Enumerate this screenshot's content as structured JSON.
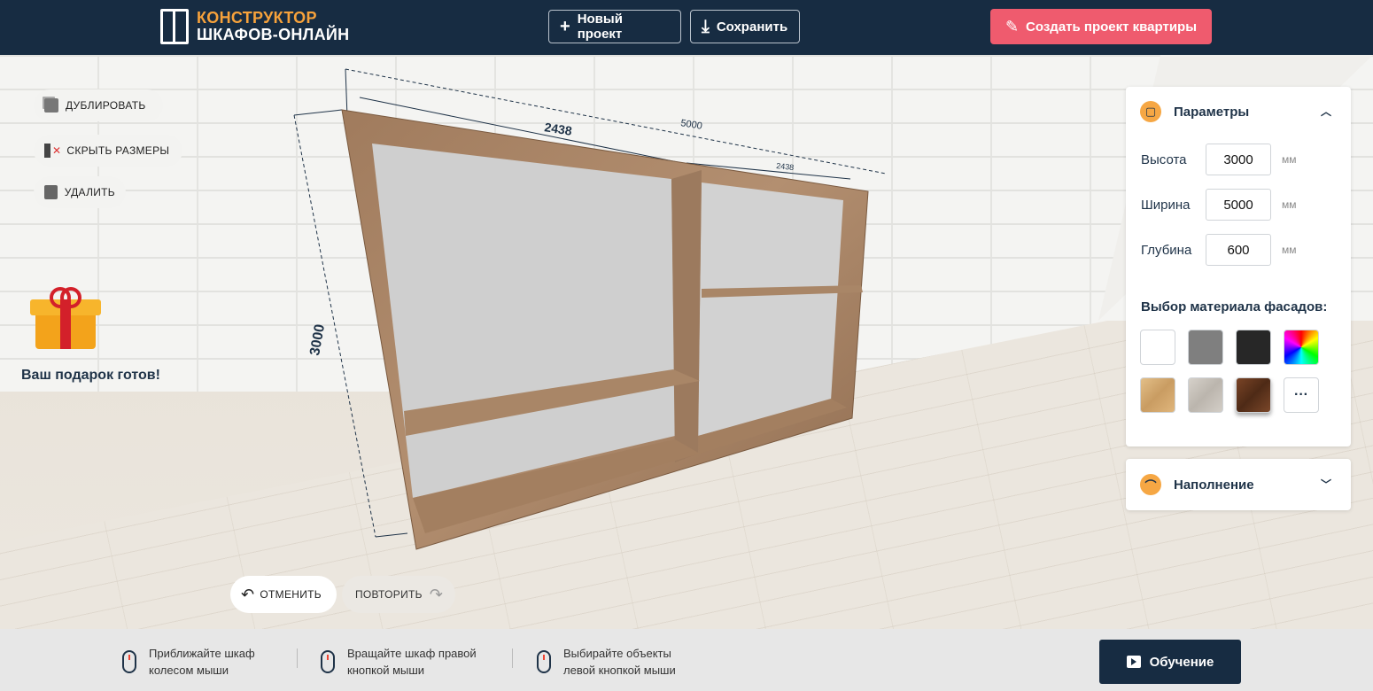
{
  "header": {
    "logo_line1": "КОНСТРУКТОР",
    "logo_line2": "ШКАФОВ-ОНЛАЙН",
    "new_project": "Новый проект",
    "save": "Сохранить",
    "create_apartment": "Создать проект квартиры"
  },
  "tools": {
    "duplicate": "ДУБЛИРОВАТЬ",
    "hide_sizes": "СКРЫТЬ РАЗМЕРЫ",
    "delete": "УДАЛИТЬ"
  },
  "gift": {
    "text": "Ваш подарок готов!"
  },
  "history": {
    "undo": "ОТМЕНИТЬ",
    "redo": "ПОВТОРИТЬ"
  },
  "dimensions": {
    "height": "3000",
    "width_total": "5000",
    "section_left": "2438",
    "section_right": "2438",
    "depth": "600"
  },
  "params": {
    "title": "Параметры",
    "height_label": "Высота",
    "height_value": "3000",
    "width_label": "Ширина",
    "width_value": "5000",
    "depth_label": "Глубина",
    "depth_value": "600",
    "unit": "мм",
    "material_title": "Выбор материала фасадов:",
    "more": "···"
  },
  "materials": [
    {
      "name": "white",
      "color": "#ffffff"
    },
    {
      "name": "gray",
      "color": "#7f7f7f"
    },
    {
      "name": "black",
      "color": "#272727"
    },
    {
      "name": "rainbow",
      "color": "conic"
    },
    {
      "name": "light-oak",
      "color": "#d9b27a"
    },
    {
      "name": "gray-stone",
      "color": "#c9c4bd"
    },
    {
      "name": "dark-walnut",
      "color": "#6b3a20"
    }
  ],
  "filling": {
    "title": "Наполнение"
  },
  "footer": {
    "hint1_l1": "Приближайте шкаф",
    "hint1_l2": "колесом мыши",
    "hint2_l1": "Вращайте шкаф правой",
    "hint2_l2": "кнопкой мыши",
    "hint3_l1": "Выбирайте объекты",
    "hint3_l2": "левой кнопкой мыши",
    "learn": "Обучение"
  }
}
